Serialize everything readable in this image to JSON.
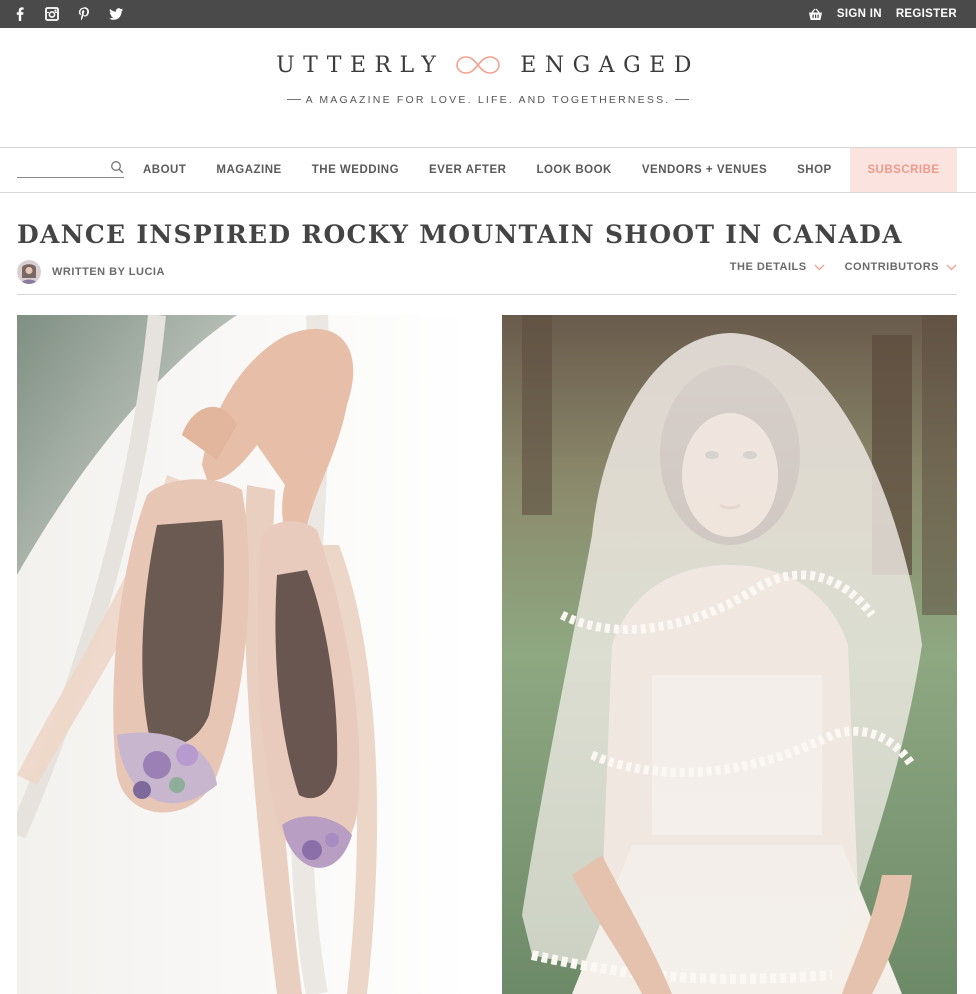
{
  "topbar": {
    "social_icons": [
      "facebook-icon",
      "instagram-icon",
      "pinterest-icon",
      "twitter-icon"
    ],
    "cart_icon": "basket-icon",
    "sign_in": "SIGN IN",
    "register": "REGISTER"
  },
  "logo": {
    "left_word": "UTTERLY",
    "right_word": "ENGAGED",
    "tagline": "A MAGAZINE FOR LOVE. LIFE. AND TOGETHERNESS."
  },
  "nav": {
    "search_placeholder": "",
    "items": [
      "ABOUT",
      "MAGAZINE",
      "THE WEDDING",
      "EVER AFTER",
      "LOOK BOOK",
      "VENDORS + VENUES",
      "SHOP"
    ],
    "subscribe": "SUBSCRIBE"
  },
  "article": {
    "title": "DANCE INSPIRED ROCKY MOUNTAIN SHOOT IN CANADA",
    "author": "WRITTEN BY LUCIA",
    "details_link": "THE DETAILS",
    "contributors_link": "CONTRIBUTORS"
  },
  "colors": {
    "topbar": "#4a4a4a",
    "accent": "#f0998a",
    "subscribe_bg": "#fbe4df"
  }
}
